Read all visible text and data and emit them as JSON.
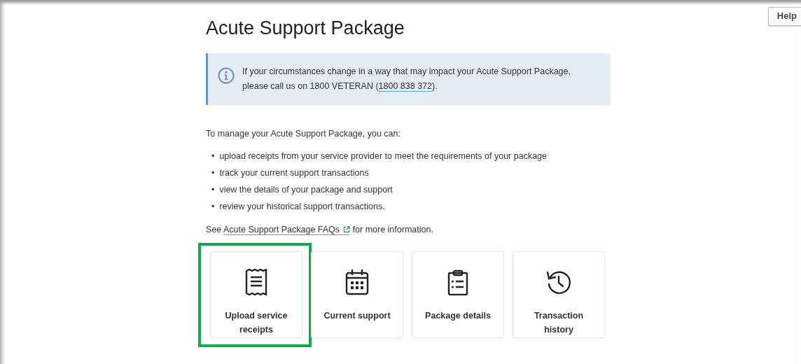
{
  "help_button": {
    "label": "Help"
  },
  "page": {
    "title": "Acute Support Package"
  },
  "notice": {
    "text": "If your circumstances change in a way that may impact your Acute Support Package, please call us on 1800 VETERAN (",
    "phone_link": "1800 838 372",
    "text_end": ")."
  },
  "intro": "To manage your Acute Support Package, you can:",
  "bullets": [
    {
      "marker": "•",
      "text": "upload receipts from your service provider to meet the requirements of your package"
    },
    {
      "marker": "•",
      "text": "track your current support transactions"
    },
    {
      "marker": "•",
      "text": "view the details of your package and support"
    },
    {
      "marker": "•",
      "text": "review your historical support transactions."
    }
  ],
  "faq_line": {
    "before": "See ",
    "link": "Acute Support Package FAQs",
    "after": " for more information."
  },
  "cards": [
    {
      "label": "Upload service receipts",
      "highlighted": true
    },
    {
      "label": "Current support",
      "highlighted": false
    },
    {
      "label": "Package details",
      "highlighted": false
    },
    {
      "label": "Transaction history",
      "highlighted": false
    }
  ]
}
